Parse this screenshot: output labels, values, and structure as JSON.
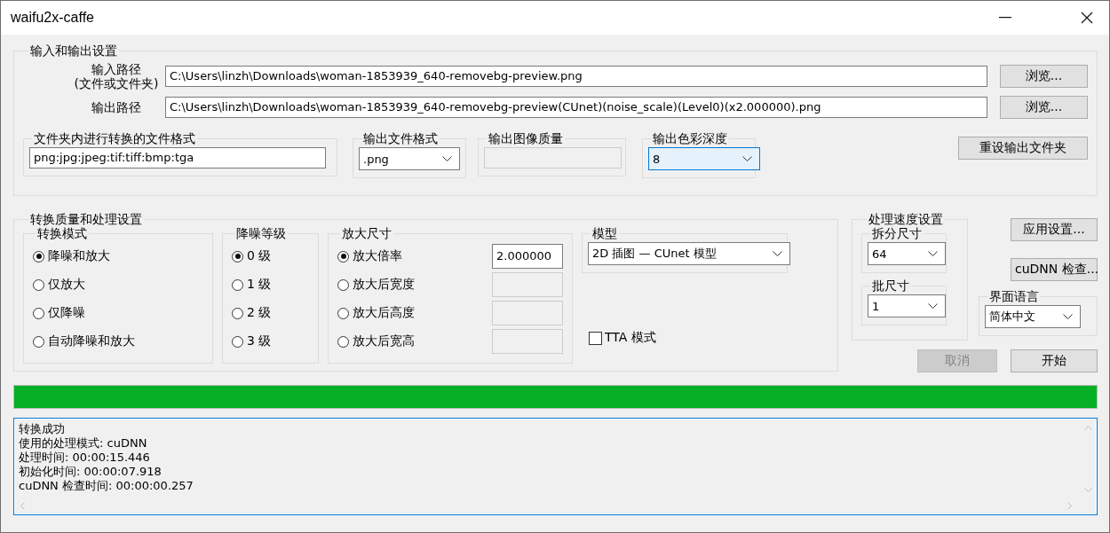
{
  "window": {
    "title": "waifu2x-caffe"
  },
  "io_settings": {
    "title": "输入和输出设置",
    "input_path": {
      "label": "输入路径",
      "sublabel": "(文件或文件夹)",
      "value": "C:\\Users\\linzh\\Downloads\\woman-1853939_640-removebg-preview.png",
      "button": "浏览..."
    },
    "output_path": {
      "label": "输出路径",
      "value": "C:\\Users\\linzh\\Downloads\\woman-1853939_640-removebg-preview(CUnet)(noise_scale)(Level0)(x2.000000).png",
      "button": "浏览..."
    },
    "folder_formats": {
      "title": "文件夹内进行转换的文件格式",
      "value": "png:jpg:jpeg:tif:tiff:bmp:tga"
    },
    "output_format": {
      "title": "输出文件格式",
      "value": ".png"
    },
    "output_quality": {
      "title": "输出图像质量",
      "disabled": true
    },
    "color_depth": {
      "title": "输出色彩深度",
      "value": "8",
      "focused": true
    },
    "reset_button": "重设输出文件夹"
  },
  "conversion": {
    "title": "转换质量和处理设置",
    "mode": {
      "title": "转换模式",
      "options": [
        {
          "label": "降噪和放大",
          "selected": true
        },
        {
          "label": "仅放大",
          "selected": false
        },
        {
          "label": "仅降噪",
          "selected": false
        },
        {
          "label": "自动降噪和放大",
          "selected": false
        }
      ]
    },
    "noise_level": {
      "title": "降噪等级",
      "options": [
        {
          "label": "0 级",
          "selected": true
        },
        {
          "label": "1 级",
          "selected": false
        },
        {
          "label": "2 级",
          "selected": false
        },
        {
          "label": "3 级",
          "selected": false
        }
      ]
    },
    "scale": {
      "title": "放大尺寸",
      "options": [
        {
          "label": "放大倍率",
          "selected": true,
          "value": "2.000000"
        },
        {
          "label": "放大后宽度",
          "selected": false
        },
        {
          "label": "放大后高度",
          "selected": false
        },
        {
          "label": "放大后宽高",
          "selected": false
        }
      ]
    },
    "model": {
      "title": "模型",
      "value": "2D 插图 — CUnet 模型"
    },
    "tta": {
      "label": "TTA 模式",
      "checked": false
    }
  },
  "speed": {
    "title": "处理速度设置",
    "split_size": {
      "title": "拆分尺寸",
      "value": "64"
    },
    "batch_size": {
      "title": "批尺寸",
      "value": "1"
    }
  },
  "side_buttons": [
    {
      "label": "应用设置...",
      "disabled": false
    },
    {
      "label": "cuDNN 检查...",
      "disabled": false
    }
  ],
  "language": {
    "title": "界面语言",
    "value": "简体中文"
  },
  "actions": [
    {
      "label": "取消",
      "disabled": true
    },
    {
      "label": "开始",
      "disabled": false
    }
  ],
  "progress": {
    "level": 1
  },
  "log": {
    "lines": [
      "转换成功",
      "使用的处理模式: cuDNN",
      "处理时间: 00:00:15.446",
      "初始化时间: 00:00:07.918",
      "cuDNN 检查时间: 00:00:00.257"
    ]
  }
}
